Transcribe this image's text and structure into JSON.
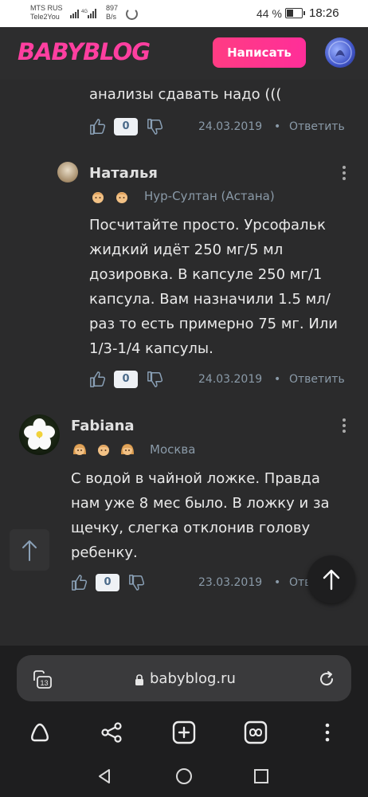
{
  "status_bar": {
    "carrier1": "MTS RUS",
    "carrier2": "Tele2You",
    "speed_value": "897",
    "speed_unit": "B/s",
    "network": "4G",
    "battery_pct": "44 %",
    "battery_level": 0.44,
    "time": "18:26"
  },
  "header": {
    "logo": "BABYBLOG",
    "write_button": "Написать"
  },
  "comments": [
    {
      "text_tail": "анализы сдавать надо (((",
      "likes": "0",
      "date": "24.03.2019",
      "reply": "Ответить"
    },
    {
      "author": "Наталья",
      "location": "Нур-Султан (Астана)",
      "badges": [
        "boy-icon",
        "boy-icon"
      ],
      "text": "Посчитайте просто. Урсофальк жидкий идёт 250 мг/5 мл дозировка. В капсуле 250 мг/1 капсула. Вам назначили 1.5 мл/раз то есть примерно 75 мг. Или 1/3-1/4 капсулы.",
      "lines": [
        "Посчитайте просто. Урсофальк",
        "жидкий идёт 250 мг/5 мл",
        "дозировка. В капсуле 250 мг/1",
        "капсула. Вам назначили 1.5 мл/",
        "раз то есть примерно 75 мг. Или",
        "1/3-1/4 капсулы."
      ],
      "likes": "0",
      "date": "24.03.2019",
      "reply": "Ответить"
    },
    {
      "author": "Fabiana",
      "location": "Москва",
      "badges": [
        "girl-icon",
        "boy-icon",
        "girl-icon"
      ],
      "lines": [
        "С водой в чайной ложке. Правда",
        "нам уже 8 мес было. В ложку и за",
        "щечку, слегка отклонив голову",
        "ребенку."
      ],
      "likes": "0",
      "date": "23.03.2019",
      "reply": "Ответить"
    }
  ],
  "browser": {
    "tabs_count": "13",
    "url": "babyblog.ru"
  },
  "colors": {
    "brand": "#ff3fa0",
    "background": "#2b2b2c",
    "meta": "#8a9aa8"
  }
}
